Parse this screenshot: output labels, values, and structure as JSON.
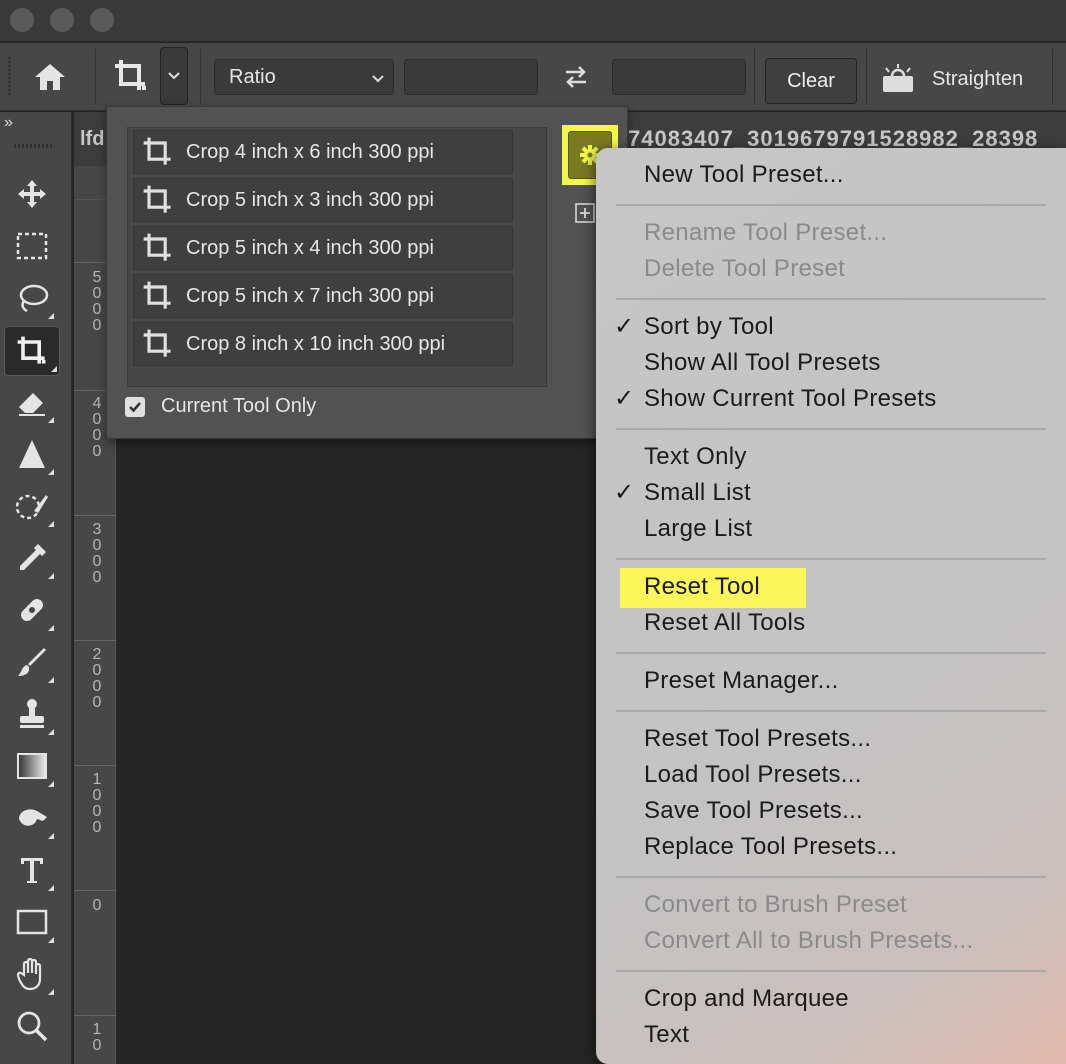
{
  "window": {
    "traffic_lights": [
      "close",
      "minimize",
      "zoom"
    ]
  },
  "options_bar": {
    "ratio_label": "Ratio",
    "width_value": "",
    "height_value": "",
    "clear_label": "Clear",
    "straighten_label": "Straighten"
  },
  "document": {
    "tab_fragment": "lfd",
    "filename_fragment": "74083407_3019679791528982_28398"
  },
  "ruler_left": {
    "labels": [
      "5000",
      "4000",
      "3000",
      "2000",
      "1000",
      "0",
      "10"
    ]
  },
  "presets_panel": {
    "presets": [
      {
        "name": "Crop 4 inch x 6 inch 300 ppi"
      },
      {
        "name": "Crop 5 inch x 3 inch 300 ppi"
      },
      {
        "name": "Crop 5 inch x 4 inch 300 ppi"
      },
      {
        "name": "Crop 5 inch x 7 inch 300 ppi"
      },
      {
        "name": "Crop 8 inch x 10 inch 300 ppi"
      }
    ],
    "current_tool_only_label": "Current Tool Only",
    "current_tool_only_checked": true
  },
  "menu": {
    "new_tool_preset": "New Tool Preset...",
    "rename_tool_preset": "Rename Tool Preset...",
    "delete_tool_preset": "Delete Tool Preset",
    "sort_by_tool": "Sort by Tool",
    "show_all_tool_presets": "Show All Tool Presets",
    "show_current_tool_presets": "Show Current Tool Presets",
    "text_only": "Text Only",
    "small_list": "Small List",
    "large_list": "Large List",
    "reset_tool": "Reset Tool",
    "reset_all_tools": "Reset All Tools",
    "preset_manager": "Preset Manager...",
    "reset_tool_presets": "Reset Tool Presets...",
    "load_tool_presets": "Load Tool Presets...",
    "save_tool_presets": "Save Tool Presets...",
    "replace_tool_presets": "Replace Tool Presets...",
    "convert_to_brush_preset": "Convert to Brush Preset",
    "convert_all_to_brush_presets": "Convert All to Brush Presets...",
    "crop_and_marquee": "Crop and Marquee",
    "text": "Text",
    "checkmark": "✓"
  },
  "colors": {
    "highlight": "#fbf659",
    "menu_bg": "#c6c6c6",
    "ui_dark": "#474747"
  },
  "icons": {
    "toolbar": [
      "move-icon",
      "marquee-icon",
      "lasso-icon",
      "crop-icon",
      "eraser-icon",
      "sharpen-icon",
      "quick-selection-icon",
      "eyedropper-icon",
      "healing-brush-icon",
      "brush-icon",
      "clone-stamp-icon",
      "gradient-icon",
      "smudge-icon",
      "type-icon",
      "shape-icon",
      "hand-icon",
      "zoom-icon"
    ]
  }
}
